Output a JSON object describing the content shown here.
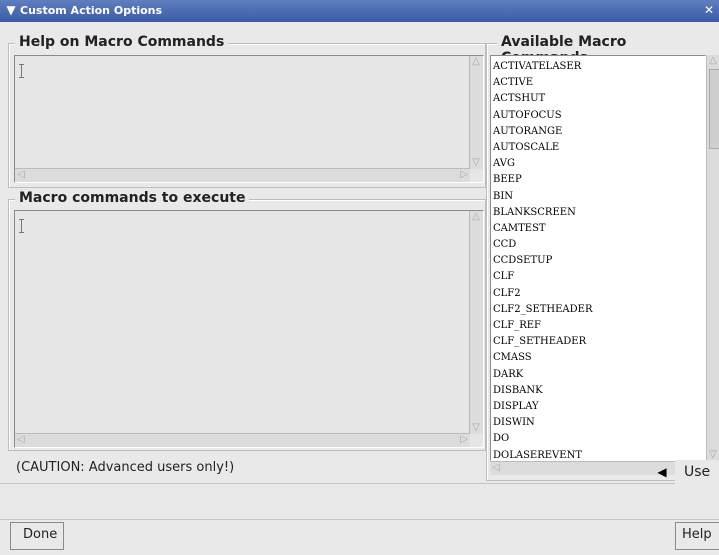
{
  "window": {
    "title": "Custom Action Options"
  },
  "help_group": {
    "label": "Help on Macro Commands"
  },
  "macro_group": {
    "label": "Macro commands to execute"
  },
  "available_group": {
    "label": "Available Macro Commands"
  },
  "caution": "(CAUTION: Advanced users only!)",
  "buttons": {
    "use": "Use",
    "done": "Done",
    "help": "Help"
  },
  "icons": {
    "window_menu": "chevron-down-icon",
    "close": "close-icon",
    "use_arrow": "left-triangle-icon"
  },
  "commands": [
    "ACTIVATELASER",
    "ACTIVE",
    "ACTSHUT",
    "AUTOFOCUS",
    "AUTORANGE",
    "AUTOSCALE",
    "AVG",
    "BEEP",
    "BIN",
    "BLANKSCREEN",
    "CAMTEST",
    "CCD",
    "CCDSETUP",
    "CLF",
    "CLF2",
    "CLF2_SETHEADER",
    "CLF_REF",
    "CLF_SETHEADER",
    "CMASS",
    "DARK",
    "DISBANK",
    "DISPLAY",
    "DISWIN",
    "DO",
    "DOLASEREVENT"
  ]
}
